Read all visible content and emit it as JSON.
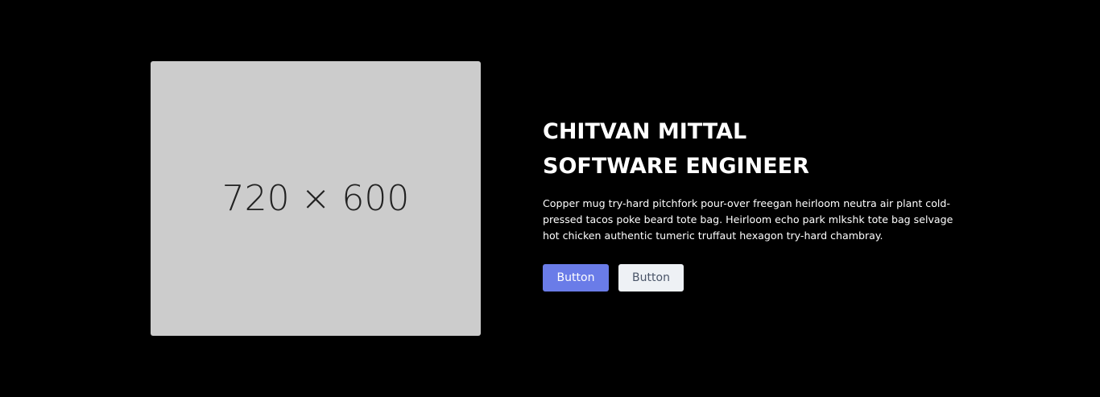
{
  "hero": {
    "image": {
      "placeholder_text": "720 × 600"
    },
    "title_line1": "CHITVAN MITTAL",
    "title_line2": "SOFTWARE ENGINEER",
    "description": "Copper mug try-hard pitchfork pour-over freegan heirloom neutra air plant cold-pressed tacos poke beard tote bag. Heirloom echo park mlkshk tote bag selvage hot chicken authentic tumeric truffaut hexagon try-hard chambray.",
    "primary_button_label": "Button",
    "secondary_button_label": "Button"
  },
  "colors": {
    "background": "#000000",
    "placeholder": "#cccccc",
    "primary_button": "#6a7ce8",
    "secondary_button": "#eef1f5"
  }
}
